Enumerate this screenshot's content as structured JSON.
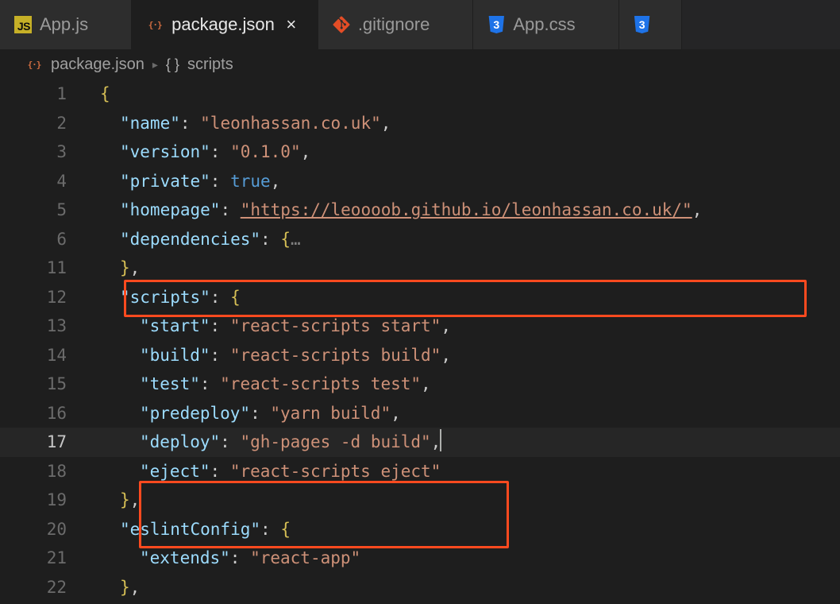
{
  "tabs": [
    {
      "icon": "js",
      "label": "App.js",
      "active": false
    },
    {
      "icon": "json",
      "label": "package.json",
      "active": true
    },
    {
      "icon": "git",
      "label": ".gitignore",
      "active": false
    },
    {
      "icon": "css",
      "label": "App.css",
      "active": false
    },
    {
      "icon": "css",
      "label": "",
      "active": false
    }
  ],
  "breadcrumb": {
    "file_icon": "json",
    "file": "package.json",
    "symbol_prefix": "{ }",
    "symbol": "scripts"
  },
  "code": {
    "name_key": "\"name\"",
    "name_val": "\"leonhassan.co.uk\"",
    "version_key": "\"version\"",
    "version_val": "\"0.1.0\"",
    "private_key": "\"private\"",
    "private_val": "true",
    "homepage_key": "\"homepage\"",
    "homepage_val": "\"https://leoooob.github.io/leonhassan.co.uk/\"",
    "dependencies_key": "\"dependencies\"",
    "folded": "…",
    "scripts_key": "\"scripts\"",
    "start_key": "\"start\"",
    "start_val": "\"react-scripts start\"",
    "build_key": "\"build\"",
    "build_val": "\"react-scripts build\"",
    "test_key": "\"test\"",
    "test_val": "\"react-scripts test\"",
    "predeploy_key": "\"predeploy\"",
    "predeploy_val": "\"yarn build\"",
    "deploy_key": "\"deploy\"",
    "deploy_val": "\"gh-pages -d build\"",
    "eject_key": "\"eject\"",
    "eject_val": "\"react-scripts eject\"",
    "eslint_key": "\"eslintConfig\"",
    "extends_key": "\"extends\"",
    "extends_val": "\"react-app\""
  },
  "line_numbers": [
    "1",
    "2",
    "3",
    "4",
    "5",
    "6",
    "11",
    "12",
    "13",
    "14",
    "15",
    "16",
    "17",
    "18",
    "19",
    "20",
    "21",
    "22"
  ],
  "current_line_index": 12
}
